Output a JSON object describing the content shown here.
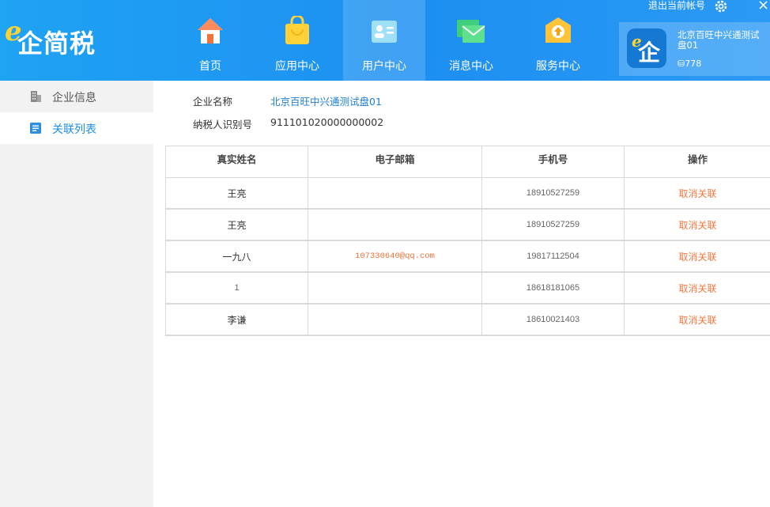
{
  "app": {
    "logo_letter": "e",
    "logo_text": "企简税"
  },
  "topbar": {
    "logout_label": "退出当前帐号",
    "close_symbol": "×"
  },
  "nav": [
    {
      "label": "首页",
      "icon": "home-icon",
      "active": false
    },
    {
      "label": "应用中心",
      "icon": "shopping-bag-icon",
      "active": false
    },
    {
      "label": "用户中心",
      "icon": "user-card-icon",
      "active": true
    },
    {
      "label": "消息中心",
      "icon": "envelope-icon",
      "active": false
    },
    {
      "label": "服务中心",
      "icon": "service-box-icon",
      "active": false
    }
  ],
  "account": {
    "company": "北京百旺中兴通测试盘01",
    "coins": "⛁778",
    "avatar_letter": "e",
    "avatar_char": "企"
  },
  "sidebar": {
    "items": [
      {
        "label": "企业信息",
        "icon": "building-icon",
        "active": false
      },
      {
        "label": "关联列表",
        "icon": "list-icon",
        "active": true
      }
    ]
  },
  "company_info": {
    "name_label": "企业名称",
    "name_value": "北京百旺中兴通测试盘01",
    "taxid_label": "纳税人识别号",
    "taxid_value": "911101020000000002"
  },
  "table": {
    "columns": [
      "真实姓名",
      "电子邮箱",
      "手机号",
      "操作"
    ],
    "rows": [
      {
        "name": "王亮",
        "email": "",
        "phone": "18910527259",
        "action": "取消关联"
      },
      {
        "name": "王亮",
        "email": "",
        "phone": "18910527259",
        "action": "取消关联"
      },
      {
        "name": "一九八",
        "email": "107330640@qq.com",
        "phone": "19817112504",
        "action": "取消关联"
      },
      {
        "name": "1",
        "email": "",
        "phone": "18618181065",
        "action": "取消关联"
      },
      {
        "name": "李谦",
        "email": "",
        "phone": "18610021403",
        "action": "取消关联"
      }
    ]
  },
  "colors": {
    "header_blue": "#1d8ff2",
    "accent_blue": "#1e8ee5",
    "action_orange": "#f07941"
  }
}
